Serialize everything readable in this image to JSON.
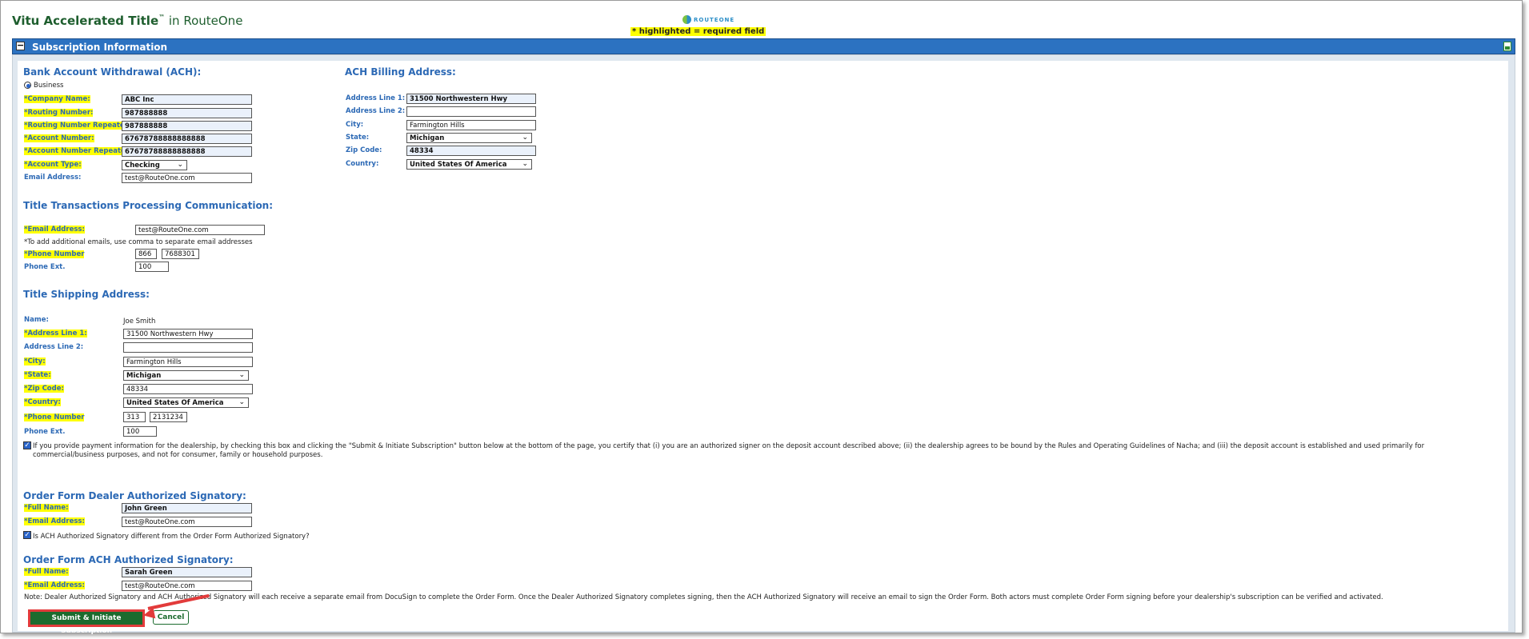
{
  "header": {
    "title_brand": "Vitu Accelerated Title",
    "title_tm": "™",
    "title_suffix": " in RouteOne",
    "logo_text": "ROUTEONE",
    "required_note": "* highlighted = required field"
  },
  "section": {
    "title": "Subscription Information"
  },
  "ach": {
    "heading": "Bank Account Withdrawal (ACH):",
    "radio_label": "Business",
    "company_name": {
      "label": "*Company Name:",
      "value": "ABC Inc"
    },
    "routing": {
      "label": "*Routing Number:",
      "value": "987888888"
    },
    "routing_repeat": {
      "label": "*Routing Number Repeated:",
      "value": "987888888"
    },
    "account": {
      "label": "*Account Number:",
      "value": "67678788888888888"
    },
    "account_repeat": {
      "label": "*Account Number Repeated:",
      "value": "67678788888888888"
    },
    "account_type": {
      "label": "*Account Type:",
      "value": "Checking"
    },
    "email": {
      "label": "Email Address:",
      "value": "test@RouteOne.com"
    }
  },
  "billing": {
    "heading": "ACH Billing Address:",
    "line1": {
      "label": "Address Line 1:",
      "value": "31500 Northwestern Hwy"
    },
    "line2": {
      "label": "Address Line 2:",
      "value": ""
    },
    "city": {
      "label": "City:",
      "value": "Farmington Hills"
    },
    "state": {
      "label": "State:",
      "value": "Michigan"
    },
    "zip": {
      "label": "Zip Code:",
      "value": "48334"
    },
    "country": {
      "label": "Country:",
      "value": "United States Of America"
    }
  },
  "comm": {
    "heading": "Title Transactions Processing Communication:",
    "email": {
      "label": "*Email Address:",
      "value": "test@RouteOne.com"
    },
    "email_note": "*To add additional emails, use comma to separate email addresses",
    "phone": {
      "label": "*Phone Number",
      "area": "866",
      "number": "7688301"
    },
    "ext": {
      "label": "Phone Ext.",
      "value": "100"
    }
  },
  "shipping": {
    "heading": "Title Shipping Address:",
    "name": {
      "label": "Name:",
      "value": "Joe Smith"
    },
    "line1": {
      "label": "*Address Line 1:",
      "value": "31500 Northwestern Hwy"
    },
    "line2": {
      "label": "Address Line 2:",
      "value": ""
    },
    "city": {
      "label": "*City:",
      "value": "Farmington Hills"
    },
    "state": {
      "label": "*State:",
      "value": "Michigan"
    },
    "zip": {
      "label": "*Zip Code:",
      "value": "48334"
    },
    "country": {
      "label": "*Country:",
      "value": "United States Of America"
    },
    "phone": {
      "label": "*Phone Number",
      "area": "313",
      "number": "2131234"
    },
    "ext": {
      "label": "Phone Ext.",
      "value": "100"
    }
  },
  "certify_text": "If you provide payment information for the dealership, by checking this box and clicking the \"Submit & Initiate Subscription\" button below at the bottom of the page, you certify that (i) you are an authorized signer on the deposit account described above; (ii) the dealership agrees to be bound by the Rules and Operating Guidelines of Nacha; and (iii) the deposit account is established and used primarily for commercial/business purposes, and not for consumer, family or household purposes.",
  "dealer_signatory": {
    "heading": "Order Form Dealer Authorized Signatory:",
    "full_name": {
      "label": "*Full Name:",
      "value": "John Green"
    },
    "email": {
      "label": "*Email Address:",
      "value": "test@RouteOne.com"
    },
    "different_label": "Is ACH Authorized Signatory different from the Order Form Authorized Signatory?"
  },
  "ach_signatory": {
    "heading": "Order Form ACH Authorized Signatory:",
    "full_name": {
      "label": "*Full Name:",
      "value": "Sarah Green"
    },
    "email": {
      "label": "*Email Address:",
      "value": "test@RouteOne.com"
    }
  },
  "note": "Note: Dealer Authorized Signatory and ACH Authorized Signatory will each receive a separate email from DocuSign to complete the Order Form. Once the Dealer Authorized Signatory completes signing, then the ACH Authorized Signatory will receive an email to sign the Order Form. Both actors must complete Order Form signing before your dealership's subscription can be verified and activated.",
  "buttons": {
    "submit": "Submit & Initiate Subscription",
    "cancel": "Cancel"
  },
  "colors": {
    "brand_green": "#1c6b2e",
    "section_blue": "#2c72c1",
    "label_blue": "#2c69b5",
    "required_highlight": "#ffff00",
    "annotation_red": "#e23b3b"
  }
}
